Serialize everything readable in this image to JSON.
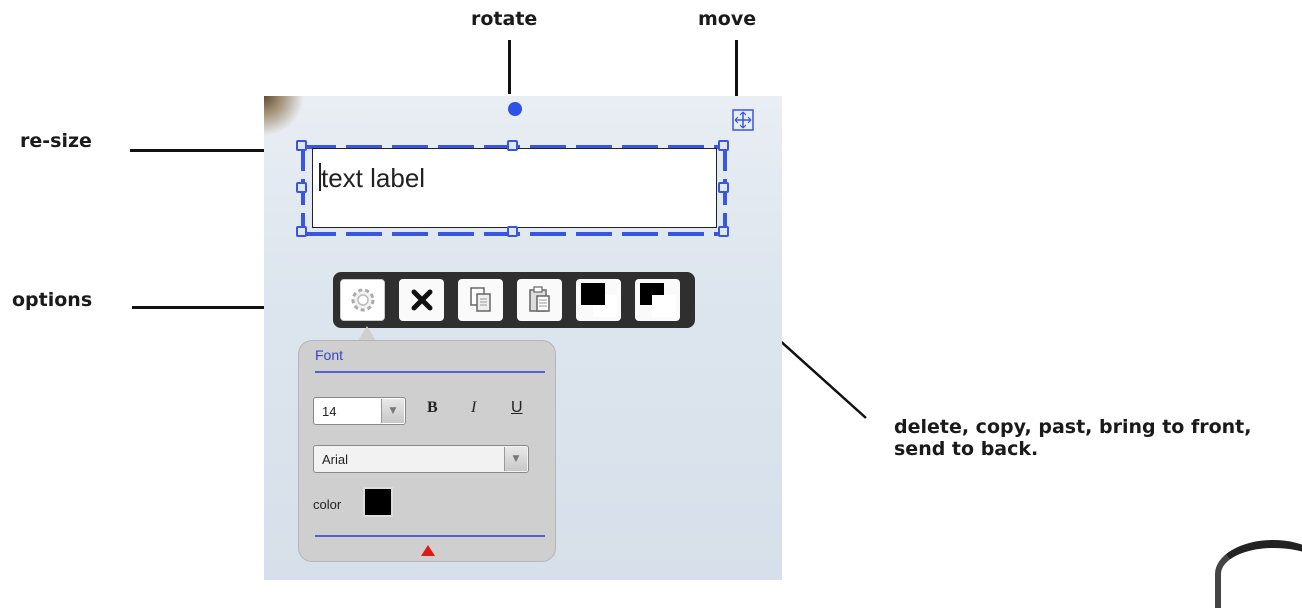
{
  "callouts": {
    "rotate": "rotate",
    "move": "move",
    "resize": "re-size",
    "options": "options",
    "actions_line1": "delete, copy, past, bring to front,",
    "actions_line2": "send to back."
  },
  "textbox": {
    "value": "text label"
  },
  "toolbar": {
    "buttons": [
      {
        "icon": "gear-icon",
        "label": "options"
      },
      {
        "icon": "delete-icon",
        "label": "delete"
      },
      {
        "icon": "copy-icon",
        "label": "copy"
      },
      {
        "icon": "paste-icon",
        "label": "paste"
      },
      {
        "icon": "bring-to-front-icon",
        "label": "bring to front"
      },
      {
        "icon": "send-to-back-icon",
        "label": "send to back"
      }
    ]
  },
  "options_panel": {
    "title": "Font",
    "font_size": "14",
    "bold_label": "B",
    "italic_label": "I",
    "underline_label": "U",
    "font_family": "Arial",
    "color_label": "color",
    "color_value": "#000000"
  },
  "colors": {
    "selection": "#3a56e0",
    "toolbar_bg": "#2f2f2f",
    "panel_bg": "#cfcfd0",
    "accent": "#3346c8",
    "collapse_arrow": "#e01818"
  }
}
